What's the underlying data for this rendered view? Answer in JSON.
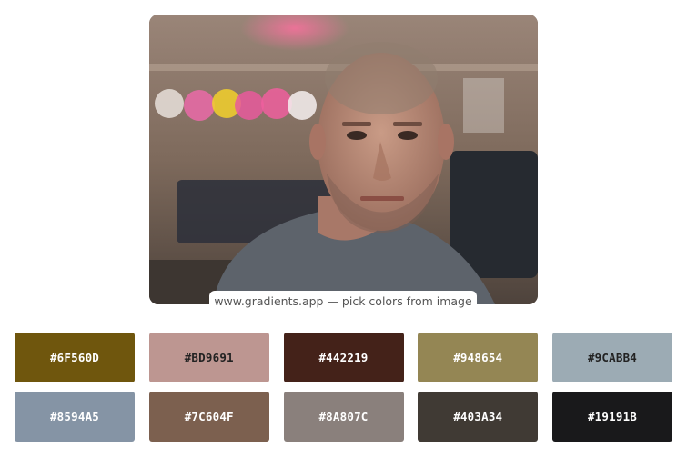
{
  "photo": {
    "icon": "portrait-photo",
    "colors": {
      "wall": "#8a7563",
      "shirt": "#5f646c",
      "skin": "#b98d78",
      "hair": "#8a7a6e",
      "chair": "#262a30"
    }
  },
  "caption": {
    "text": "www.gradients.app — pick colors from image"
  },
  "palette": [
    {
      "hex": "#6F560D",
      "label": "#6F560D",
      "text_color": "#ffffff"
    },
    {
      "hex": "#BD9691",
      "label": "#BD9691",
      "text_color": "#222222"
    },
    {
      "hex": "#442219",
      "label": "#442219",
      "text_color": "#ffffff"
    },
    {
      "hex": "#948654",
      "label": "#948654",
      "text_color": "#ffffff"
    },
    {
      "hex": "#9CABB4",
      "label": "#9CABB4",
      "text_color": "#222222"
    },
    {
      "hex": "#8594A5",
      "label": "#8594A5",
      "text_color": "#ffffff"
    },
    {
      "hex": "#7C604F",
      "label": "#7C604F",
      "text_color": "#ffffff"
    },
    {
      "hex": "#8A807C",
      "label": "#8A807C",
      "text_color": "#ffffff"
    },
    {
      "hex": "#403A34",
      "label": "#403A34",
      "text_color": "#ffffff"
    },
    {
      "hex": "#19191B",
      "label": "#19191B",
      "text_color": "#ffffff"
    }
  ]
}
